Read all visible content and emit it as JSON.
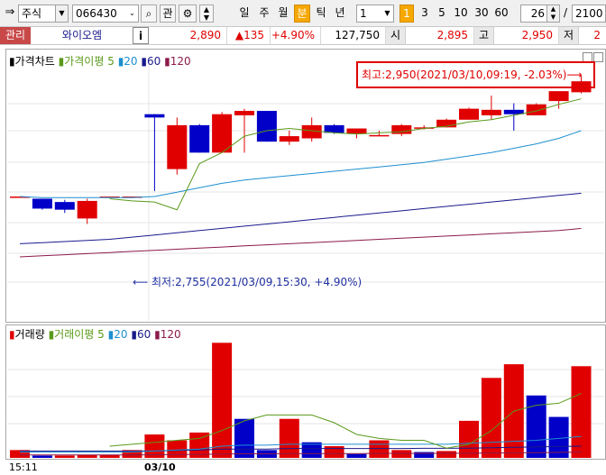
{
  "toolbar": {
    "market": "주식",
    "code": "066430",
    "btn_gwan": "관",
    "periods": [
      "일",
      "주",
      "월",
      "분",
      "틱",
      "년"
    ],
    "active_period": "분",
    "interval": "1",
    "minute_options": [
      "1",
      "3",
      "5",
      "10",
      "30",
      "60"
    ],
    "active_minute": "1",
    "count": "26",
    "slash": "/",
    "total": "2100"
  },
  "quote": {
    "tag": "관리",
    "name": "와이오엠",
    "info": "i",
    "price": "2,890",
    "change": "▲135",
    "change_pct": "+4.90%",
    "volume": "127,750",
    "open_label": "시",
    "open": "2,895",
    "high_label": "고",
    "high": "2,950",
    "low_label": "저",
    "low": "2"
  },
  "price_legend": {
    "title": "가격차트",
    "ma_label": "가격이평",
    "ma_periods": [
      "5",
      "20",
      "60",
      "120"
    ]
  },
  "volume_legend": {
    "title": "거래량",
    "ma_label": "거래이평",
    "ma_periods": [
      "5",
      "20",
      "60",
      "120"
    ]
  },
  "annotations": {
    "high": "최고:2,950(2021/03/10,09:19, -2.03%)⟶",
    "low": "⟵ 최저:2,755(2021/03/09,15:30, +4.90%)"
  },
  "x_labels": [
    "15:11",
    "03/10"
  ],
  "colors": {
    "up": "#e00000",
    "down": "#0000c8",
    "ma5": "#5a9a1a",
    "ma20": "#1e8fd0",
    "ma60": "#1a1a8c",
    "ma120": "#8c1a4a"
  },
  "chart_data": [
    {
      "type": "candlestick",
      "title": "가격차트",
      "ylim": [
        2730,
        2955
      ],
      "candles": [
        {
          "o": 2840,
          "h": 2840,
          "l": 2840,
          "c": 2840
        },
        {
          "o": 2838,
          "h": 2838,
          "l": 2828,
          "c": 2829
        },
        {
          "o": 2835,
          "h": 2837,
          "l": 2825,
          "c": 2828
        },
        {
          "o": 2820,
          "h": 2838,
          "l": 2815,
          "c": 2836
        },
        {
          "o": 2840,
          "h": 2840,
          "l": 2840,
          "c": 2840
        },
        {
          "o": 2840,
          "h": 2840,
          "l": 2840,
          "c": 2840
        },
        {
          "o": 2915,
          "h": 2915,
          "l": 2845,
          "c": 2912
        },
        {
          "o": 2865,
          "h": 2912,
          "l": 2860,
          "c": 2905
        },
        {
          "o": 2905,
          "h": 2906,
          "l": 2880,
          "c": 2880
        },
        {
          "o": 2880,
          "h": 2917,
          "l": 2880,
          "c": 2915
        },
        {
          "o": 2914,
          "h": 2920,
          "l": 2880,
          "c": 2918
        },
        {
          "o": 2918,
          "h": 2918,
          "l": 2890,
          "c": 2890
        },
        {
          "o": 2890,
          "h": 2900,
          "l": 2887,
          "c": 2895
        },
        {
          "o": 2893,
          "h": 2912,
          "l": 2890,
          "c": 2905
        },
        {
          "o": 2905,
          "h": 2906,
          "l": 2897,
          "c": 2898
        },
        {
          "o": 2897,
          "h": 2900,
          "l": 2893,
          "c": 2902
        },
        {
          "o": 2896,
          "h": 2900,
          "l": 2895,
          "c": 2896
        },
        {
          "o": 2897,
          "h": 2906,
          "l": 2895,
          "c": 2905
        },
        {
          "o": 2902,
          "h": 2905,
          "l": 2901,
          "c": 2903
        },
        {
          "o": 2903,
          "h": 2911,
          "l": 2903,
          "c": 2910
        },
        {
          "o": 2910,
          "h": 2921,
          "l": 2910,
          "c": 2920
        },
        {
          "o": 2914,
          "h": 2932,
          "l": 2910,
          "c": 2919
        },
        {
          "o": 2919,
          "h": 2925,
          "l": 2900,
          "c": 2915
        },
        {
          "o": 2914,
          "h": 2925,
          "l": 2914,
          "c": 2924
        },
        {
          "o": 2927,
          "h": 2934,
          "l": 2920,
          "c": 2936
        },
        {
          "o": 2935,
          "h": 2950,
          "l": 2934,
          "c": 2945
        }
      ],
      "ma5": [
        null,
        null,
        null,
        null,
        2838,
        2836,
        2835,
        2828,
        2870,
        2880,
        2895,
        2900,
        2902,
        2900,
        2898,
        2897,
        2898,
        2899,
        2902,
        2904,
        2908,
        2910,
        2914,
        2918,
        2924,
        2929
      ],
      "ma20": [
        2840,
        2839,
        2839,
        2839,
        2839,
        2839,
        2840,
        2844,
        2848,
        2852,
        2855,
        2857,
        2859,
        2861,
        2863,
        2865,
        2867,
        2869,
        2871,
        2874,
        2877,
        2880,
        2884,
        2888,
        2893,
        2900
      ],
      "ma60": [
        2797,
        2798,
        2799,
        2800,
        2801,
        2803,
        2805,
        2807,
        2809,
        2811,
        2813,
        2815,
        2817,
        2819,
        2821,
        2823,
        2825,
        2827,
        2829,
        2831,
        2833,
        2835,
        2837,
        2839,
        2841,
        2843
      ],
      "ma120": [
        2785,
        2786,
        2787,
        2788,
        2789,
        2790,
        2791,
        2792,
        2793,
        2794,
        2795,
        2796,
        2797,
        2798,
        2799,
        2800,
        2801,
        2802,
        2803,
        2804,
        2805,
        2806,
        2807,
        2808,
        2809,
        2811
      ]
    },
    {
      "type": "bar",
      "title": "거래량",
      "ylim": [
        0,
        6100
      ],
      "values": [
        400,
        120,
        120,
        150,
        150,
        400,
        1200,
        900,
        1300,
        5900,
        2000,
        400,
        2000,
        800,
        600,
        200,
        900,
        400,
        300,
        350,
        1900,
        4100,
        4800,
        3200,
        2100,
        4700
      ],
      "up": [
        true,
        false,
        true,
        true,
        true,
        true,
        true,
        true,
        true,
        true,
        false,
        false,
        true,
        false,
        true,
        false,
        true,
        true,
        false,
        true,
        true,
        true,
        true,
        false,
        false,
        true
      ],
      "ma5": [
        null,
        null,
        null,
        null,
        600,
        700,
        800,
        900,
        1000,
        1400,
        1900,
        2200,
        2200,
        2200,
        1800,
        1200,
        1000,
        900,
        900,
        500,
        700,
        1400,
        2400,
        2700,
        2800,
        3300
      ],
      "ma20": [
        300,
        300,
        300,
        300,
        300,
        300,
        350,
        400,
        450,
        600,
        650,
        650,
        700,
        700,
        700,
        700,
        700,
        700,
        700,
        700,
        750,
        800,
        850,
        900,
        1000,
        1100
      ],
      "ma60": [
        350,
        350,
        350,
        350,
        350,
        350,
        350,
        380,
        400,
        450,
        450,
        450,
        480,
        480,
        480,
        480,
        480,
        480,
        490,
        490,
        500,
        520,
        540,
        560,
        580,
        600
      ],
      "ma120": [
        150,
        150,
        150,
        150,
        150,
        150,
        160,
        170,
        180,
        200,
        210,
        210,
        220,
        220,
        220,
        220,
        230,
        230,
        230,
        230,
        240,
        250,
        260,
        270,
        280,
        290
      ]
    }
  ]
}
